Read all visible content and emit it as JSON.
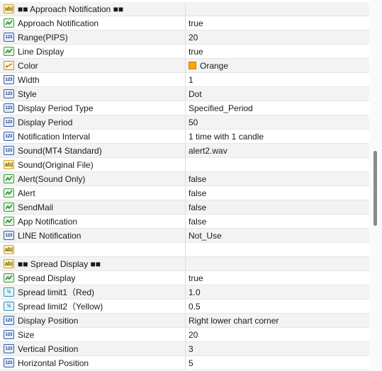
{
  "rows": [
    {
      "label": "■■ Approach Notification ■■",
      "value": "",
      "icon": "ab"
    },
    {
      "label": "Approach Notification",
      "value": "true",
      "icon": "bool"
    },
    {
      "label": "Range(PIPS)",
      "value": "20",
      "icon": "int"
    },
    {
      "label": "Line Display",
      "value": "true",
      "icon": "bool"
    },
    {
      "label": "Color",
      "value": "Orange",
      "icon": "color",
      "swatch": "#ffa500"
    },
    {
      "label": "Width",
      "value": "1",
      "icon": "int"
    },
    {
      "label": "Style",
      "value": "Dot",
      "icon": "int"
    },
    {
      "label": "Display Period Type",
      "value": "Specified_Period",
      "icon": "int"
    },
    {
      "label": "Display Period",
      "value": "50",
      "icon": "int"
    },
    {
      "label": "Notification Interval",
      "value": "1 time with 1 candle",
      "icon": "int"
    },
    {
      "label": "Sound(MT4 Standard)",
      "value": "alert2.wav",
      "icon": "int"
    },
    {
      "label": "Sound(Original File)",
      "value": "",
      "icon": "ab"
    },
    {
      "label": "Alert(Sound Only)",
      "value": "false",
      "icon": "bool"
    },
    {
      "label": "Alert",
      "value": "false",
      "icon": "bool"
    },
    {
      "label": "SendMail",
      "value": "false",
      "icon": "bool"
    },
    {
      "label": "App Notification",
      "value": "false",
      "icon": "bool"
    },
    {
      "label": "LINE Notification",
      "value": "Not_Use",
      "icon": "int"
    },
    {
      "label": "",
      "value": "",
      "icon": "ab"
    },
    {
      "label": "■■ Spread Display ■■",
      "value": "",
      "icon": "ab"
    },
    {
      "label": "Spread Display",
      "value": "true",
      "icon": "bool"
    },
    {
      "label": "Spread limit1（Red)",
      "value": "1.0",
      "icon": "double"
    },
    {
      "label": "Spread limit2（Yellow)",
      "value": "0.5",
      "icon": "double"
    },
    {
      "label": "Display Position",
      "value": "Right lower chart corner",
      "icon": "int"
    },
    {
      "label": "Size",
      "value": "20",
      "icon": "int"
    },
    {
      "label": "Vertical Position",
      "value": "3",
      "icon": "int"
    },
    {
      "label": "Horizontal Position",
      "value": "5",
      "icon": "int"
    }
  ],
  "icon_text": {
    "ab": "ab|",
    "int": "123",
    "double": "½"
  },
  "colors": {
    "bool_stroke": "#2e8b2e",
    "color_stroke": "#c9873d"
  }
}
